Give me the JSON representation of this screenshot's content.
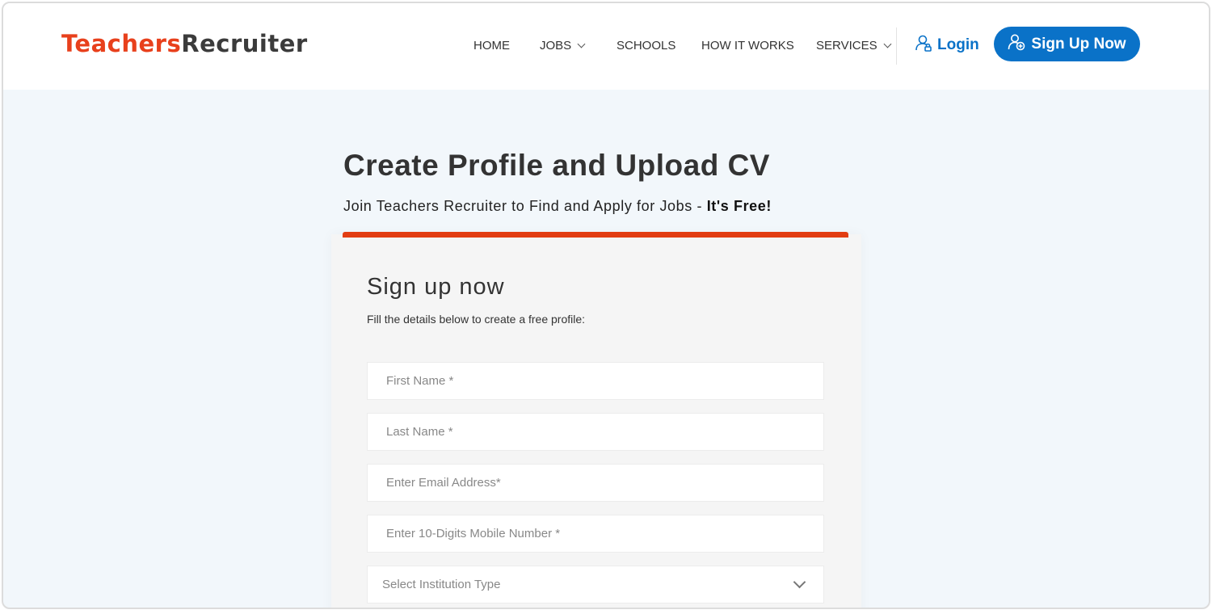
{
  "brand": {
    "part1": "Teachers",
    "part2": "Recruiter"
  },
  "nav": {
    "home": "HOME",
    "jobs": "JOBS",
    "schools": "SCHOOLS",
    "how_it_works": "HOW IT WORKS",
    "services": "SERVICES",
    "login": "Login",
    "signup": "Sign Up Now"
  },
  "hero": {
    "title": "Create Profile and Upload CV",
    "subtitle_prefix": "Join Teachers Recruiter to Find and Apply for Jobs - ",
    "subtitle_bold": "It's Free!"
  },
  "form": {
    "title": "Sign up now",
    "description": "Fill the details below to create a free profile:",
    "first_name_placeholder": "First Name *",
    "last_name_placeholder": "Last Name *",
    "email_placeholder": "Enter Email Address*",
    "mobile_placeholder": "Enter 10-Digits Mobile Number *",
    "institution_placeholder": "Select Institution Type"
  },
  "colors": {
    "brand_orange": "#e8401c",
    "primary_blue": "#0a72c8",
    "accent_bar": "#e23d12",
    "page_bg": "#f2f7fb"
  },
  "icons": {
    "login": "user-lock-icon",
    "signup": "user-plus-icon",
    "dropdown": "chevron-down-icon"
  }
}
